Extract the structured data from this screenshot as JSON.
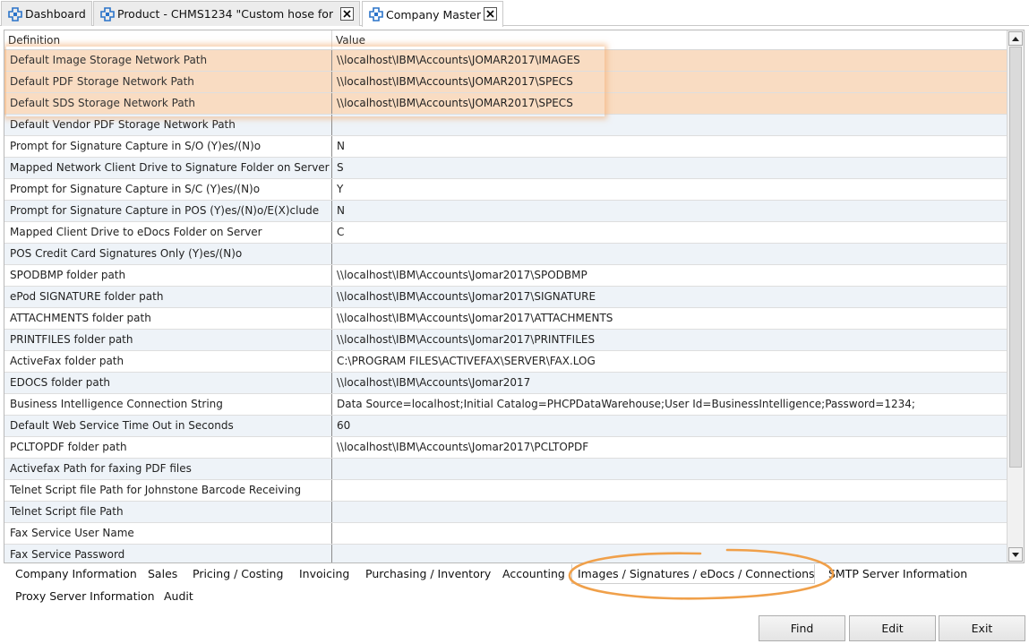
{
  "tabs": [
    {
      "label": "Dashboard",
      "closable": false,
      "active": false
    },
    {
      "label": "Product - CHMS1234 \"Custom hose for",
      "closable": true,
      "active": false
    },
    {
      "label": "Company Master",
      "closable": true,
      "active": true
    }
  ],
  "grid": {
    "columns": [
      "Definition",
      "Value"
    ],
    "rows": [
      {
        "definition": "Default Image Storage Network Path",
        "value": "\\\\localhost\\IBM\\Accounts\\JOMAR2017\\IMAGES",
        "highlighted": true
      },
      {
        "definition": "Default PDF Storage Network Path",
        "value": "\\\\localhost\\IBM\\Accounts\\JOMAR2017\\SPECS",
        "highlighted": true
      },
      {
        "definition": "Default SDS Storage Network Path",
        "value": "\\\\localhost\\IBM\\Accounts\\JOMAR2017\\SPECS",
        "highlighted": true
      },
      {
        "definition": "Default Vendor PDF Storage Network Path",
        "value": ""
      },
      {
        "definition": "Prompt for Signature Capture in S/O (Y)es/(N)o",
        "value": "N"
      },
      {
        "definition": "Mapped Network Client Drive to Signature Folder on Server",
        "value": "S"
      },
      {
        "definition": "Prompt for Signature Capture in S/C (Y)es/(N)o",
        "value": "Y"
      },
      {
        "definition": "Prompt for Signature Capture in POS (Y)es/(N)o/E(X)clude",
        "value": "N"
      },
      {
        "definition": "Mapped Client Drive to eDocs Folder on Server",
        "value": "C"
      },
      {
        "definition": "POS Credit Card Signatures Only (Y)es/(N)o",
        "value": ""
      },
      {
        "definition": "SPODBMP folder path",
        "value": "\\\\localhost\\IBM\\Accounts\\Jomar2017\\SPODBMP"
      },
      {
        "definition": "ePod SIGNATURE folder path",
        "value": "\\\\localhost\\IBM\\Accounts\\Jomar2017\\SIGNATURE"
      },
      {
        "definition": "ATTACHMENTS folder path",
        "value": "\\\\localhost\\IBM\\Accounts\\Jomar2017\\ATTACHMENTS"
      },
      {
        "definition": "PRINTFILES folder path",
        "value": "\\\\localhost\\IBM\\Accounts\\Jomar2017\\PRINTFILES"
      },
      {
        "definition": "ActiveFax folder path",
        "value": "C:\\PROGRAM FILES\\ACTIVEFAX\\SERVER\\FAX.LOG"
      },
      {
        "definition": "EDOCS folder path",
        "value": "\\\\localhost\\IBM\\Accounts\\Jomar2017"
      },
      {
        "definition": "Business Intelligence Connection String",
        "value": "Data Source=localhost;Initial Catalog=PHCPDataWarehouse;User Id=BusinessIntelligence;Password=1234;"
      },
      {
        "definition": "Default Web Service Time Out in Seconds",
        "value": "60"
      },
      {
        "definition": "PCLTOPDF folder path",
        "value": "\\\\localhost\\IBM\\Accounts\\Jomar2017\\PCLTOPDF"
      },
      {
        "definition": "Activefax Path for faxing PDF files",
        "value": ""
      },
      {
        "definition": "Telnet Script file Path for Johnstone Barcode Receiving",
        "value": ""
      },
      {
        "definition": "Telnet Script file Path",
        "value": ""
      },
      {
        "definition": "Fax Service User Name",
        "value": ""
      },
      {
        "definition": "Fax Service Password",
        "value": ""
      }
    ]
  },
  "section_tabs": [
    {
      "label": "Company Information",
      "active": false
    },
    {
      "label": "Sales",
      "active": false
    },
    {
      "label": "Pricing / Costing",
      "active": false
    },
    {
      "label": "Invoicing",
      "active": false
    },
    {
      "label": "Purchasing / Inventory",
      "active": false
    },
    {
      "label": "Accounting",
      "active": false
    },
    {
      "label": "Images / Signatures / eDocs / Connections",
      "active": true
    },
    {
      "label": "SMTP Server Information",
      "active": false
    },
    {
      "label": "Proxy Server Information",
      "active": false
    },
    {
      "label": "Audit",
      "active": false
    }
  ],
  "buttons": {
    "find": "Find",
    "edit": "Edit",
    "exit": "Exit"
  },
  "colors": {
    "highlight": "#f9dcc2",
    "alt_row": "#eef3f8",
    "annotation": "#f0a04a",
    "tab_icon": "#2a73c9"
  }
}
